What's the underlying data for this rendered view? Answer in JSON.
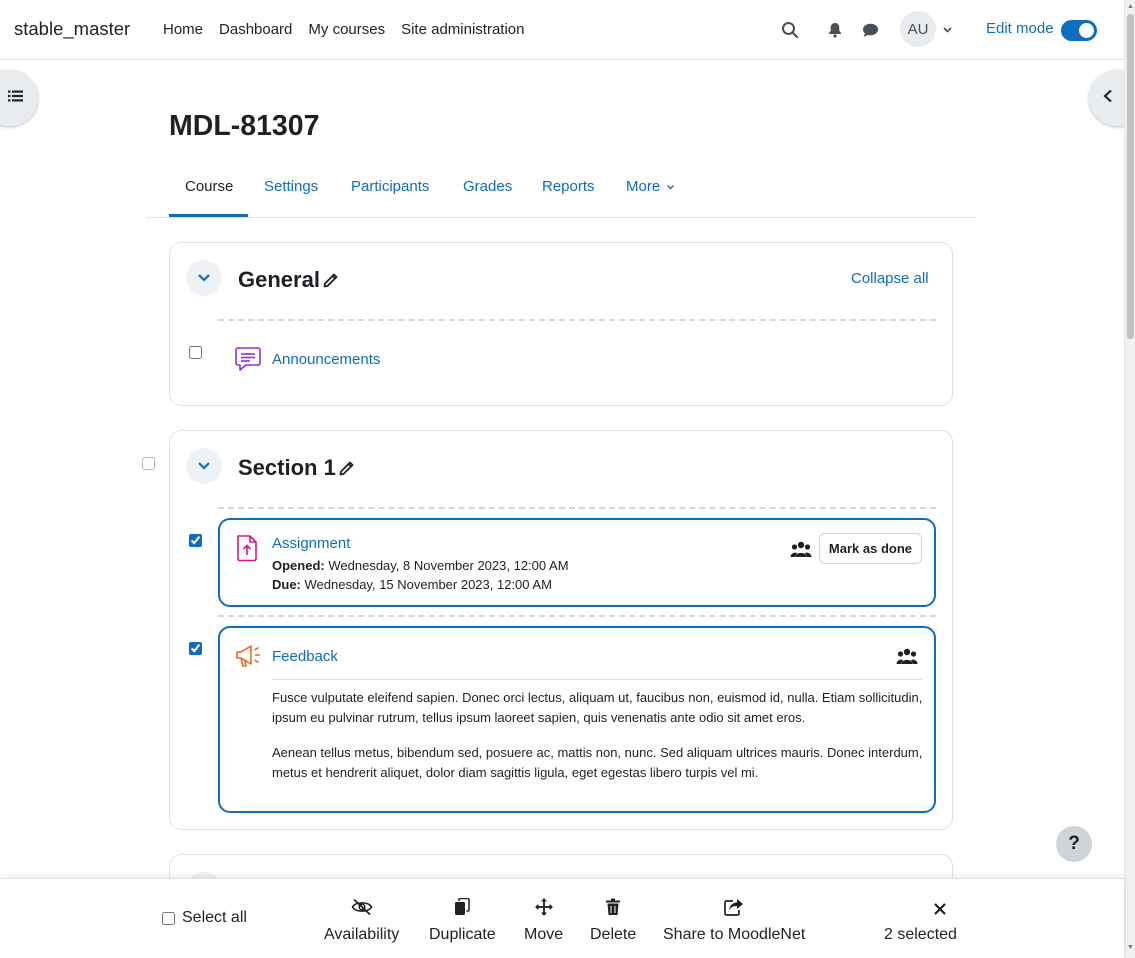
{
  "navbar": {
    "brand": "stable_master",
    "items": [
      "Home",
      "Dashboard",
      "My courses",
      "Site administration"
    ],
    "user_initials": "AU",
    "edit_mode_label": "Edit mode",
    "edit_mode_on": true
  },
  "page": {
    "title": "MDL-81307",
    "tabs": [
      "Course",
      "Settings",
      "Participants",
      "Grades",
      "Reports",
      "More"
    ],
    "active_tab": "Course"
  },
  "sections": {
    "general": {
      "title": "General",
      "collapse_all": "Collapse all",
      "activity": {
        "name": "Announcements",
        "icon": "forum-icon",
        "checked": false
      }
    },
    "section1": {
      "title": "Section 1",
      "assignment": {
        "name": "Assignment",
        "icon": "assignment-icon",
        "checked": true,
        "opened_label": "Opened:",
        "opened_value": "Wednesday, 8 November 2023, 12:00 AM",
        "due_label": "Due:",
        "due_value": "Wednesday, 15 November 2023, 12:00 AM",
        "mark_done": "Mark as done"
      },
      "feedback": {
        "name": "Feedback",
        "icon": "feedback-icon",
        "checked": true,
        "paragraph1": "Fusce vulputate eleifend sapien. Donec orci lectus, aliquam ut, faucibus non, euismod id, nulla. Etiam sollicitudin, ipsum eu pulvinar rutrum, tellus ipsum laoreet sapien, quis venenatis ante odio sit amet eros.",
        "paragraph2": "Aenean tellus metus, bibendum sed, posuere ac, mattis non, nunc. Sed aliquam ultrices mauris. Donec interdum, metus et hendrerit aliquet, dolor diam sagittis ligula, eget egestas libero turpis vel mi."
      }
    }
  },
  "help": {
    "label": "?"
  },
  "bulk": {
    "select_all": "Select all",
    "actions": [
      "Availability",
      "Duplicate",
      "Move",
      "Delete",
      "Share to MoodleNet"
    ],
    "selected_count": "2 selected"
  },
  "colors": {
    "accent": "#0f6cbf",
    "assignment_icon": "#d81b7a",
    "feedback_icon": "#eb6a1c",
    "forum_icon": "#8f2ee6"
  }
}
